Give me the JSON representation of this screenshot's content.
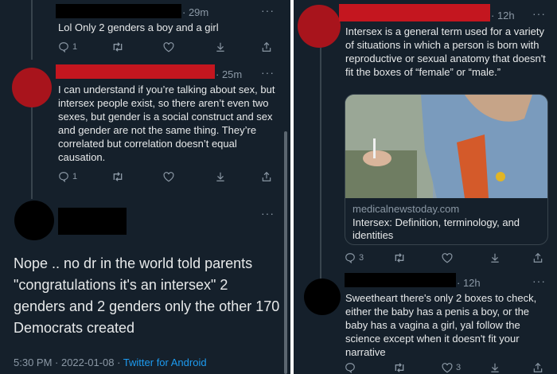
{
  "colors": {
    "background": "#15202b",
    "text": "#e7e9ea",
    "muted": "#8b98a5",
    "link": "#1d9bf0",
    "border": "#38444d",
    "redaction_red": "#c4161f",
    "avatar_red": "#a8141c"
  },
  "left": {
    "tweet1": {
      "time": "29m",
      "text": "Lol Only 2 genders a boy and a girl",
      "reply_count": "1"
    },
    "tweet2": {
      "time": "25m",
      "text": "I can understand if you’re talking about sex, but intersex people exist, so there aren’t even two sexes, but gender is a social construct and sex and gender are not the same thing. They’re correlated but correlation doesn’t equal causation.",
      "reply_count": "1"
    },
    "main_tweet": {
      "text": "Nope .. no dr in the world told parents \"congratulations it's an intersex\" 2 genders and 2 genders only the other 170 Democrats created",
      "timestamp": "5:30 PM · 2022-01-08 ·",
      "source": "Twitter for Android"
    }
  },
  "right": {
    "tweet1": {
      "time": "12h",
      "text": "Intersex is a general term used for a variety of situations in which a person is born with reproductive or sexual anatomy that doesn't fit the boxes of “female” or “male.”",
      "card_domain": "medicalnewstoday.com",
      "card_title": "Intersex: Definition, terminology, and identities",
      "reply_count": "3"
    },
    "tweet2": {
      "time": "12h",
      "text": "Sweetheart there's only 2 boxes to check, either the baby has a penis a boy, or the baby has a vagina a girl, yal follow the science except when it doesn't fit your narrative",
      "like_count": "3"
    }
  },
  "icons": [
    "reply-icon",
    "retweet-icon",
    "like-icon",
    "download-icon",
    "share-icon",
    "more-icon"
  ]
}
